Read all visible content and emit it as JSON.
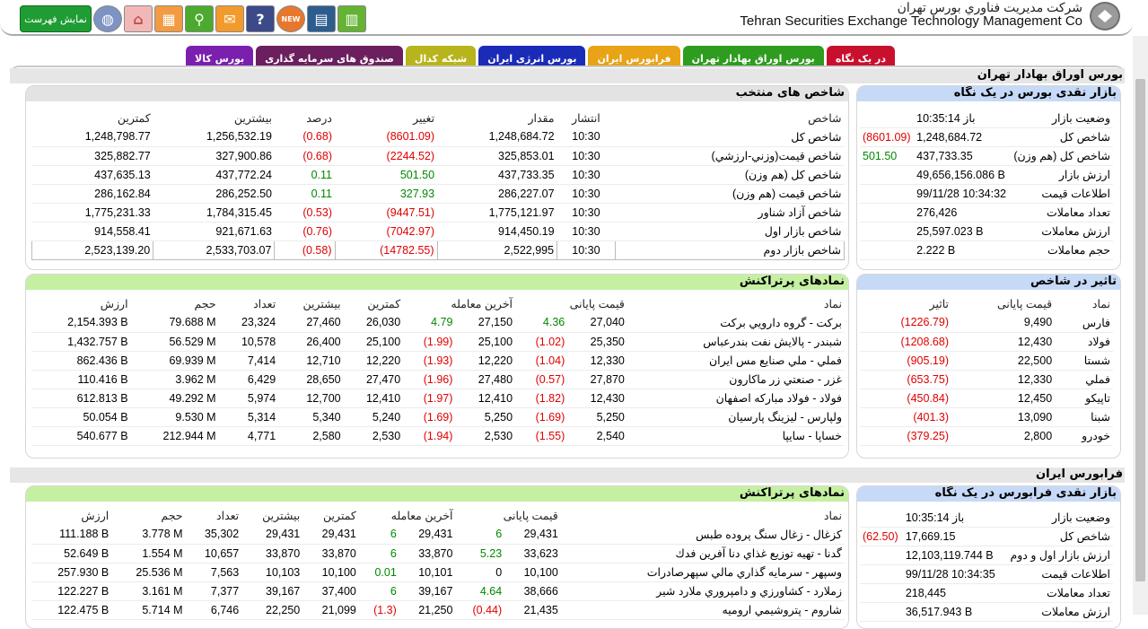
{
  "header": {
    "company_fa": "شركت مديريت فناوري بورس تهران",
    "company_en": "Tehran Securities Exchange Technology Management Co",
    "show_list": "نمایش فهرست"
  },
  "toolbar_icons": [
    "dashboard-icon",
    "book-icon",
    "new-badge-icon",
    "help-icon",
    "message-icon",
    "search-icon",
    "table-icon",
    "home-icon",
    "globe-icon"
  ],
  "tabs": [
    {
      "label": "در یک نگاه",
      "color": "#c8102e"
    },
    {
      "label": "بورس اوراق بهادار تهران",
      "color": "#2e9c1f"
    },
    {
      "label": "فرابورس ایران",
      "color": "#e8a317"
    },
    {
      "label": "بورس انرژی ایران",
      "color": "#1a2bb8"
    },
    {
      "label": "شبکه کدال",
      "color": "#b7b51b"
    },
    {
      "label": "صندوق های سرمایه گذاری",
      "color": "#6b1f5e"
    },
    {
      "label": "بورس کالا",
      "color": "#7b1fae"
    }
  ],
  "tse": {
    "section": "بورس اوراق بهادار تهران",
    "cash_title": "بازار نقدی بورس در یک نگاه",
    "cash": [
      {
        "label": "وضعیت بازار",
        "value": "باز 10:35:14",
        "chg": ""
      },
      {
        "label": "شاخص کل",
        "value": "1,248,684.72",
        "chg": "(8601.09)"
      },
      {
        "label": "شاخص کل (هم وزن)",
        "value": "437,733.35",
        "chg": "501.50"
      },
      {
        "label": "ارزش بازار",
        "value": "49,656,156.086 B",
        "chg": ""
      },
      {
        "label": "اطلاعات قیمت",
        "value": "99/11/28 10:34:32",
        "chg": ""
      },
      {
        "label": "تعداد معاملات",
        "value": "276,426",
        "chg": ""
      },
      {
        "label": "ارزش معاملات",
        "value": "25,597.023 B",
        "chg": ""
      },
      {
        "label": "حجم معاملات",
        "value": "2.222 B",
        "chg": ""
      }
    ],
    "idx_title": "شاخص های منتخب",
    "idx_cols": [
      "شاخص",
      "انتشار",
      "مقدار",
      "تغییر",
      "درصد",
      "بیشترین",
      "کمترین"
    ],
    "idx": [
      [
        "شاخص کل",
        "10:30",
        "1,248,684.72",
        "(8601.09)",
        "(0.68)",
        "1,256,532.19",
        "1,248,798.77"
      ],
      [
        "شاخص قيمت(وزني-ارزشي)",
        "10:30",
        "325,853.01",
        "(2244.52)",
        "(0.68)",
        "327,900.86",
        "325,882.77"
      ],
      [
        "شاخص کل (هم وزن)",
        "10:30",
        "437,733.35",
        "501.50",
        "0.11",
        "437,772.24",
        "437,635.13"
      ],
      [
        "شاخص قیمت (هم وزن)",
        "10:30",
        "286,227.07",
        "327.93",
        "0.11",
        "286,252.50",
        "286,162.84"
      ],
      [
        "شاخص آزاد شناور",
        "10:30",
        "1,775,121.97",
        "(9447.51)",
        "(0.53)",
        "1,784,315.45",
        "1,775,231.33"
      ],
      [
        "شاخص بازار اول",
        "10:30",
        "914,450.19",
        "(7042.97)",
        "(0.76)",
        "921,671.63",
        "914,558.41"
      ],
      [
        "شاخص بازار دوم",
        "10:30",
        "2,522,995",
        "(14782.55)",
        "(0.58)",
        "2,533,703.07",
        "2,523,139.20"
      ]
    ],
    "impact_title": "تاثیر در شاخص",
    "impact_cols": [
      "نماد",
      "قیمت پایانی",
      "تاثیر"
    ],
    "impact": [
      [
        "فارس",
        "9,490",
        "(1226.79)"
      ],
      [
        "فولاد",
        "12,430",
        "(1208.68)"
      ],
      [
        "شستا",
        "22,500",
        "(905.19)"
      ],
      [
        "فملي",
        "12,330",
        "(653.75)"
      ],
      [
        "تاپيكو",
        "12,450",
        "(450.84)"
      ],
      [
        "شبنا",
        "13,090",
        "(401.3)"
      ],
      [
        "خودرو",
        "2,800",
        "(379.25)"
      ]
    ],
    "active_title": "نمادهای پرتراکنش",
    "active_cols": [
      "نماد",
      "قیمت پایانی",
      "",
      "آخرین معامله",
      "",
      "کمترین",
      "بیشترین",
      "تعداد",
      "حجم",
      "ارزش"
    ],
    "active": [
      [
        "برکت - گروه دارويي بركت",
        "27,040",
        "4.36",
        "27,150",
        "4.79",
        "26,030",
        "27,460",
        "23,324",
        "79.688 M",
        "2,154.393 B"
      ],
      [
        "شبندر - پالايش نفت بندرعباس",
        "25,350",
        "(1.02)",
        "25,100",
        "(1.99)",
        "25,100",
        "26,400",
        "10,578",
        "56.529 M",
        "1,432.757 B"
      ],
      [
        "فملي - ملي صنايع مس ايران",
        "12,330",
        "(1.04)",
        "12,220",
        "(1.93)",
        "12,220",
        "12,710",
        "7,414",
        "69.939 M",
        "862.436 B"
      ],
      [
        "غزر - صنعتي زر ماكارون",
        "27,870",
        "(0.57)",
        "27,480",
        "(1.96)",
        "27,470",
        "28,650",
        "6,429",
        "3.962 M",
        "110.416 B"
      ],
      [
        "فولاد - فولاد مباركه اصفهان",
        "12,430",
        "(1.82)",
        "12,410",
        "(1.97)",
        "12,410",
        "12,700",
        "5,974",
        "49.292 M",
        "612.813 B"
      ],
      [
        "ولپارس - ليزينگ پارسيان",
        "5,250",
        "(1.69)",
        "5,250",
        "(1.69)",
        "5,240",
        "5,340",
        "5,314",
        "9.530 M",
        "50.054 B"
      ],
      [
        "خساپا - سايپا",
        "2,540",
        "(1.55)",
        "2,530",
        "(1.94)",
        "2,530",
        "2,580",
        "4,771",
        "212.944 M",
        "540.677 B"
      ]
    ]
  },
  "ifb": {
    "section": "فرابورس ایران",
    "cash_title": "بازار نقدی فرابورس در یک نگاه",
    "cash": [
      {
        "label": "وضعیت بازار",
        "value": "باز 10:35:14",
        "chg": ""
      },
      {
        "label": "شاخص کل",
        "value": "17,669.15",
        "chg": "(62.50)"
      },
      {
        "label": "ارزش بازار اول و دوم",
        "value": "12,103,119.744 B",
        "chg": ""
      },
      {
        "label": "اطلاعات قیمت",
        "value": "99/11/28 10:34:35",
        "chg": ""
      },
      {
        "label": "تعداد معاملات",
        "value": "218,445",
        "chg": ""
      },
      {
        "label": "ارزش معاملات",
        "value": "36,517.943 B",
        "chg": ""
      }
    ],
    "active_title": "نمادهای پرتراکنش",
    "active": [
      [
        "كزغال - زغال سنگ پروده طبس",
        "29,431",
        "6",
        "29,431",
        "6",
        "29,431",
        "29,431",
        "35,302",
        "3.778 M",
        "111.188 B"
      ],
      [
        "گدنا - تهيه توزيع غذاي دنا آفرين فدك",
        "33,623",
        "5.23",
        "33,870",
        "6",
        "33,870",
        "33,870",
        "10,657",
        "1.554 M",
        "52.649 B"
      ],
      [
        "وسپهر - سرمايه گذاري مالي سپهرصادرات",
        "10,100",
        "0",
        "10,101",
        "0.01",
        "10,100",
        "10,103",
        "7,563",
        "25.536 M",
        "257.930 B"
      ],
      [
        "زملارد - كشاورزي و دامپروري ملارد شير",
        "38,666",
        "4.64",
        "39,167",
        "6",
        "37,400",
        "39,167",
        "7,377",
        "3.161 M",
        "122.227 B"
      ],
      [
        "شاروم - پتروشيمي اروميه",
        "21,435",
        "(0.44)",
        "21,250",
        "(1.3)",
        "21,099",
        "22,250",
        "6,746",
        "5.714 M",
        "122.475 B"
      ]
    ]
  }
}
